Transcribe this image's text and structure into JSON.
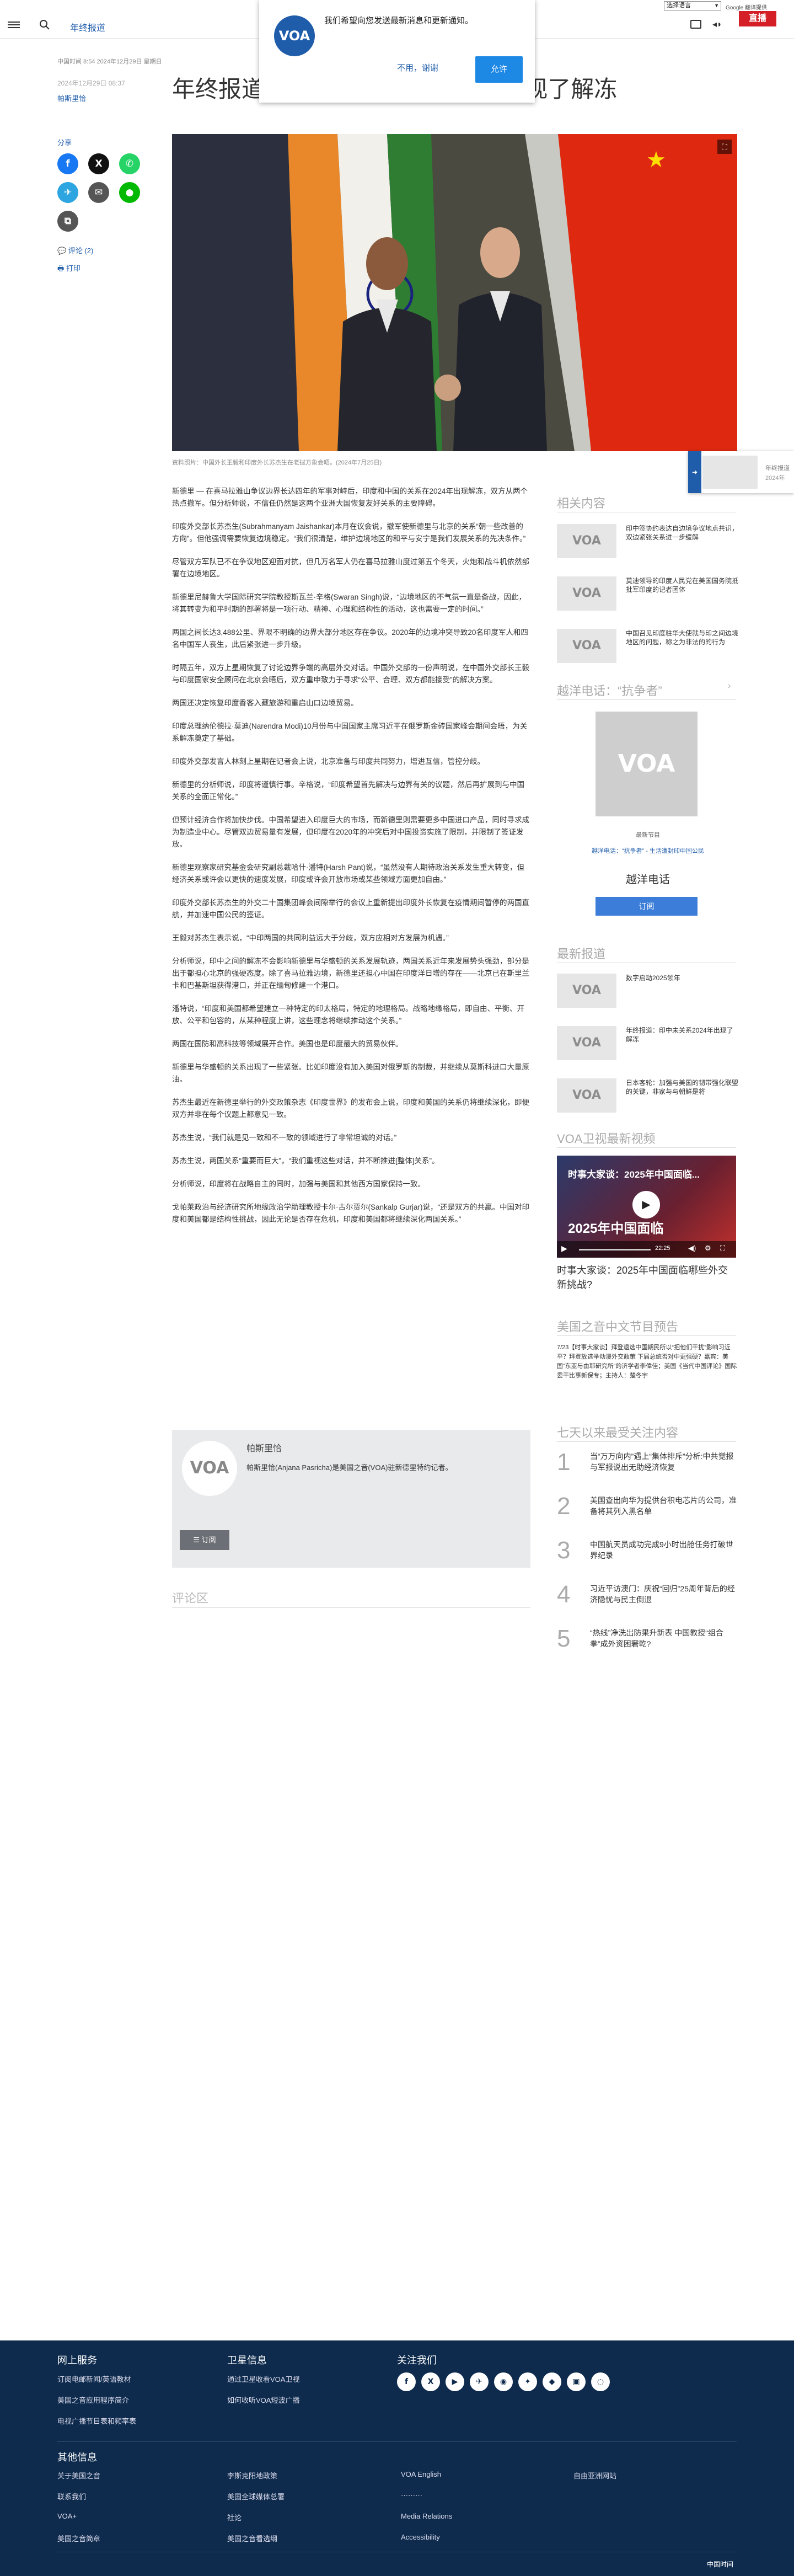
{
  "topbar": {
    "lang_select": "选择语言",
    "google_label": "Google 翻译提供"
  },
  "header": {
    "section": "年终报道",
    "live": "直播"
  },
  "notify": {
    "logo": "VOA",
    "message": "我们希望向您发送最新消息和更新通知。",
    "decline": "不用，谢谢",
    "accept": "允许"
  },
  "article": {
    "meta": "中国时间 8:54 2024年12月29日 星期日",
    "date": "2024年12月29日 08:37",
    "author": "帕斯里恰",
    "headline": "年终报道：印中京原关系2024年出现了解冻",
    "caption": "资料照片：中国外长王毅和印度外长苏杰生在老挝万象会晤。(2024年7月25日)",
    "paragraphs": [
      "新德里 — 在喜马拉雅山争议边界长达四年的军事对峙后，印度和中国的关系在2024年出现解冻，双方从两个热点撤军。但分析师说，不信任仍然是这两个亚洲大国恢复友好关系的主要障碍。",
      "印度外交部长苏杰生(Subrahmanyam Jaishankar)本月在议会说，撤军使新德里与北京的关系“朝一些改善的方向”。但他强调需要恢复边境稳定。“我们很清楚，维护边境地区的和平与安宁是我们发展关系的先决条件。”",
      "尽管双方军队已不在争议地区迎面对抗，但几万名军人仍在喜马拉雅山度过第五个冬天，火炮和战斗机依然部署在边境地区。",
      "新德里尼赫鲁大学国际研究学院教授斯瓦兰·辛格(Swaran Singh)说，“边境地区的不气氛一直是备战，因此，将其转变为和平时期的部署将是一项行动、精神、心理和结构性的活动，这也需要一定的时间。”",
      "两国之间长达3,488公里、界限不明确的边界大部分地区存在争议。2020年的边境冲突导致20名印度军人和四名中国军人丧生，此后紧张进一步升级。",
      "时隔五年，双方上星期恢复了讨论边界争端的高层外交对话。中国外交部的一份声明说，在中国外交部长王毅与印度国家安全顾问在北京会晤后，双方重申致力于寻求“公平、合理、双方都能接受”的解决方案。",
      "两国还决定恢复印度香客入藏旅游和重启山口边境贸易。",
      "印度总理纳伦德拉·莫迪(Narendra Modi)10月份与中国国家主席习近平在俄罗斯金砖国家峰会期间会晤，为关系解冻奠定了基础。",
      "印度外交部发言人林刻上星期在记者会上说，北京准备与印度共同努力，增进互信，管控分歧。",
      "新德里的分析师说，印度将谨慎行事。辛格说，“印度希望首先解决与边界有关的议题，然后再扩展到与中国关系的全面正常化。”",
      "但预计经济合作将加快步伐。中国希望进入印度巨大的市场，而新德里则需要更多中国进口产品，同时寻求成为制造业中心。尽管双边贸易量有发展，但印度在2020年的冲突后对中国投资实施了限制，并限制了签证发放。",
      "新德里观察家研究基金会研究副总裁哈什·潘特(Harsh Pant)说，“虽然没有人期待政治关系发生重大转变，但经济关系或许会以更快的速度发展，印度或许会开放市场或某些领域方面更加自由。”",
      "印度外交部长苏杰生的外交二十国集团峰会间隙举行的会议上重新提出印度外长恢复在疫情期间暂停的两国直航，并加速中国公民的签证。",
      "王毅对苏杰生表示说，“中印两国的共同利益远大于分歧，双方应相对方发展为机遇。”",
      "分析师说，印中之间的解冻不会影响新德里与华盛顿的关系发展轨迹，两国关系近年来发展势头强劲，部分是出于都担心北京的强硬态度。除了喜马拉雅边境，新德里还担心中国在印度洋日增的存在——北京已在斯里兰卡和巴基斯坦获得港口，并正在缅甸修建一个港口。",
      "潘特说，“印度和美国都希望建立一种特定的印太格局，特定的地理格局。战略地缘格局，即自由、平衡、开放、公平和包容的，从某种程度上讲，这些理念将继续推动这个关系。”",
      "两国在国防和高科技等领域展开合作。美国也是印度最大的贸易伙伴。",
      "新德里与华盛顿的关系出现了一些紧张。比如印度没有加入美国对俄罗斯的制裁，并继续从莫斯科进口大量原油。",
      "苏杰生最近在新德里举行的外交政策杂志《印度世界》的发布会上说，印度和美国的关系仍将继续深化，即便双方并非在每个议题上都意见一致。",
      "苏杰生说，“我们就是见一致和不一致的领域进行了非常坦诚的对话。”",
      "苏杰生说，两国关系“重要而巨大”，“我们重视这些对话，并不断推进[整体]关系”。",
      "分析师说，印度将在战略自主的同时，加强与美国和其他西方国家保持一致。",
      "戈帕莱政治与经济研究所地缘政治学助理教授卡尔·古尔贾尔(Sankalp Gurjar)说，“还是双方的共赢。中国对印度和美国都是结构性挑战，因此无论是否存在危机，印度和美国都将继续深化两国关系。”"
    ]
  },
  "share": {
    "label": "分享",
    "comments": "评论 (2)",
    "print": "打印"
  },
  "mini_player": {
    "title": "年终报道",
    "date": "2024年"
  },
  "author_box": {
    "avatar": "VOA",
    "name": "帕斯里恰",
    "bio": "帕斯里恰(Anjana Pasricha)是美国之音(VOA)驻新德里特约记者。",
    "subscribe": "订阅"
  },
  "comments_title": "评论区",
  "sidebar": {
    "related_title": "相关内容",
    "related": [
      {
        "thumb": "VOA",
        "title": "印中签协约表达自边境争议地点共识，双边紧张关系进一步缓解"
      },
      {
        "thumb": "VOA",
        "title": "莫迪领导的印度人民党在美国国务院抵批军印度的记者团体"
      },
      {
        "thumb": "VOA",
        "title": "中国召见印度驻华大使就与印之间边境地区的问题，称之为非法的的行为"
      }
    ],
    "radio_title": "越洋电话：“抗争者”",
    "radio_label": "最新节目",
    "radio_link": "越洋电话：“抗争者” - 生活遭封印中国公民",
    "radio_name": "越洋电话",
    "radio_subscribe": "订阅",
    "latest_title": "最新报道",
    "latest": [
      {
        "thumb": "VOA",
        "title": "数字启动2025领年"
      },
      {
        "thumb": "VOA",
        "title": "年终报道：印中未关系2024年出现了解冻"
      },
      {
        "thumb": "VOA",
        "title": "日本客轮：加强与美国的韧带强化联盟的关键，非家与与朝鲜是将"
      }
    ],
    "video_title": "VOA卫视最新视频",
    "video_overlay": "时事大家谈：2025年中国面临...",
    "video_banner": "2025年中国面临",
    "video_time": "22:25",
    "video_caption": "时事大家谈：2025年中国面临哪些外交新挑战?",
    "schedule_title": "美国之音中文节目预告",
    "schedule_text": "7/23【时事大家谈】拜登退选中国期民所以“把他们干扰”影响习近平？拜登放选举动漫外交政策 下届总统否对中更强硬？嘉宾：美国“东亚与由耶研究所”的济学者李偉佳；美国《当代中国评论》国际委干比事新保专；主持人：楚冬宇",
    "popular_title": "七天以来最受关注内容",
    "popular": [
      {
        "n": "1",
        "title": "当“万万向内”遇上“集体排斥”分析:中共觉报与军报说出无助经济恢复"
      },
      {
        "n": "2",
        "title": "美国查出向华为提供台积电芯片的公司，准备将其列入黑名单"
      },
      {
        "n": "3",
        "title": "中国航天员成功完成9小时出舱任务打破世界纪录"
      },
      {
        "n": "4",
        "title": "习近平访澳门：庆祝“回归”25周年背后的经济隐忧与民主倒退"
      },
      {
        "n": "5",
        "title": "“热线”净洗出防果升新表 中国教授“组合拳”成外资困窘乾?"
      }
    ]
  },
  "footer": {
    "online_title": "网上服务",
    "online": [
      "订阅电邮新闻/英语教材",
      "美国之音应用程序简介",
      "电视广播节目表和频率表"
    ],
    "satellite_title": "卫星信息",
    "satellite": [
      "通过卫星收看VOA卫视",
      "如何收听VOA短波广播"
    ],
    "follow_title": "关注我们",
    "social": [
      "f",
      "X",
      "▶",
      "✈",
      "◉",
      "✦",
      "◆",
      "▣",
      "◌"
    ],
    "other_title": "其他信息",
    "col1": [
      "关于美国之音",
      "联系我们",
      "VOA+",
      "美国之音简章"
    ],
    "col2": [
      "李斯克阳地政策",
      "美国全球媒体总署",
      "社论",
      "美国之音看选纲"
    ],
    "col3": [
      "VOA English",
      "⋯⋯⋯",
      "Media Relations",
      "Accessibility"
    ],
    "col4": [
      "自由亚洲网站"
    ],
    "time_label": "中国时间"
  }
}
